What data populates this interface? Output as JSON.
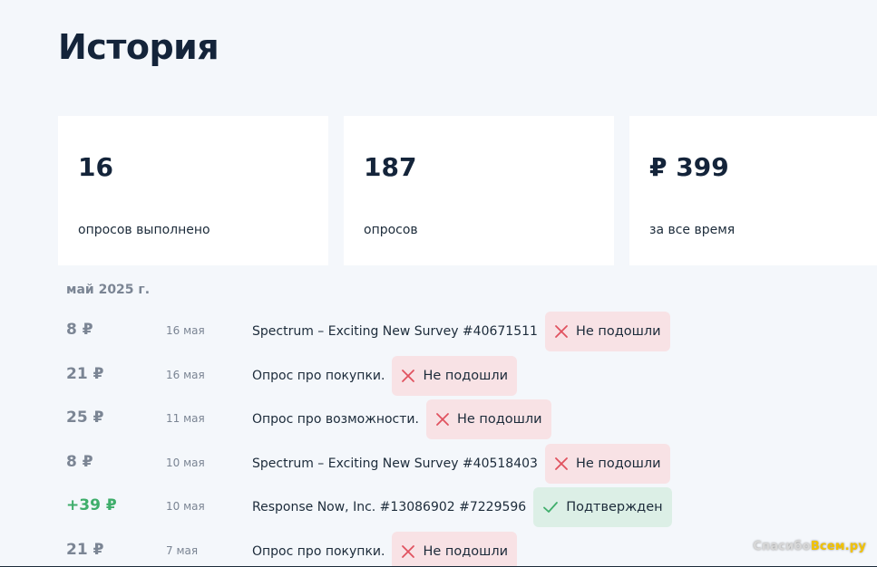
{
  "page": {
    "title": "История"
  },
  "stats": [
    {
      "value": "16",
      "label": "опросов выполнено"
    },
    {
      "value": "187",
      "label": "опросов"
    },
    {
      "value": "₽ 399",
      "label": "за все время"
    }
  ],
  "history": {
    "month": "май 2025 г.",
    "rows": [
      {
        "amount": "8 ₽",
        "date": "16 мая",
        "survey": "Spectrum – Exciting New Survey #40671511",
        "status": "Не подошли",
        "status_type": "rejected"
      },
      {
        "amount": "21 ₽",
        "date": "16 мая",
        "survey": "Опрос про покупки.",
        "status": "Не подошли",
        "status_type": "rejected"
      },
      {
        "amount": "25 ₽",
        "date": "11 мая",
        "survey": "Опрос про возможности.",
        "status": "Не подошли",
        "status_type": "rejected"
      },
      {
        "amount": "8 ₽",
        "date": "10 мая",
        "survey": "Spectrum – Exciting New Survey #40518403",
        "status": "Не подошли",
        "status_type": "rejected"
      },
      {
        "amount": "+39 ₽",
        "date": "10 мая",
        "survey": "Response Now, Inc. #13086902 #7229596",
        "status": "Подтвержден",
        "status_type": "confirmed"
      },
      {
        "amount": "21 ₽",
        "date": "7 мая",
        "survey": "Опрос про покупки.",
        "status": "Не подошли",
        "status_type": "rejected"
      }
    ]
  },
  "watermark": {
    "part1": "Спаси",
    "part2": "бо",
    "part3": "Всем.ру"
  },
  "icons": {
    "rejected": "close-x-icon",
    "confirmed": "checkmark-icon"
  },
  "colors": {
    "rejected_bg": "#f8e2e5",
    "rejected_icon": "#e0525f",
    "confirmed_bg": "#dcefe6",
    "confirmed_icon": "#3fae6b",
    "positive_amount": "#3fae6b"
  }
}
